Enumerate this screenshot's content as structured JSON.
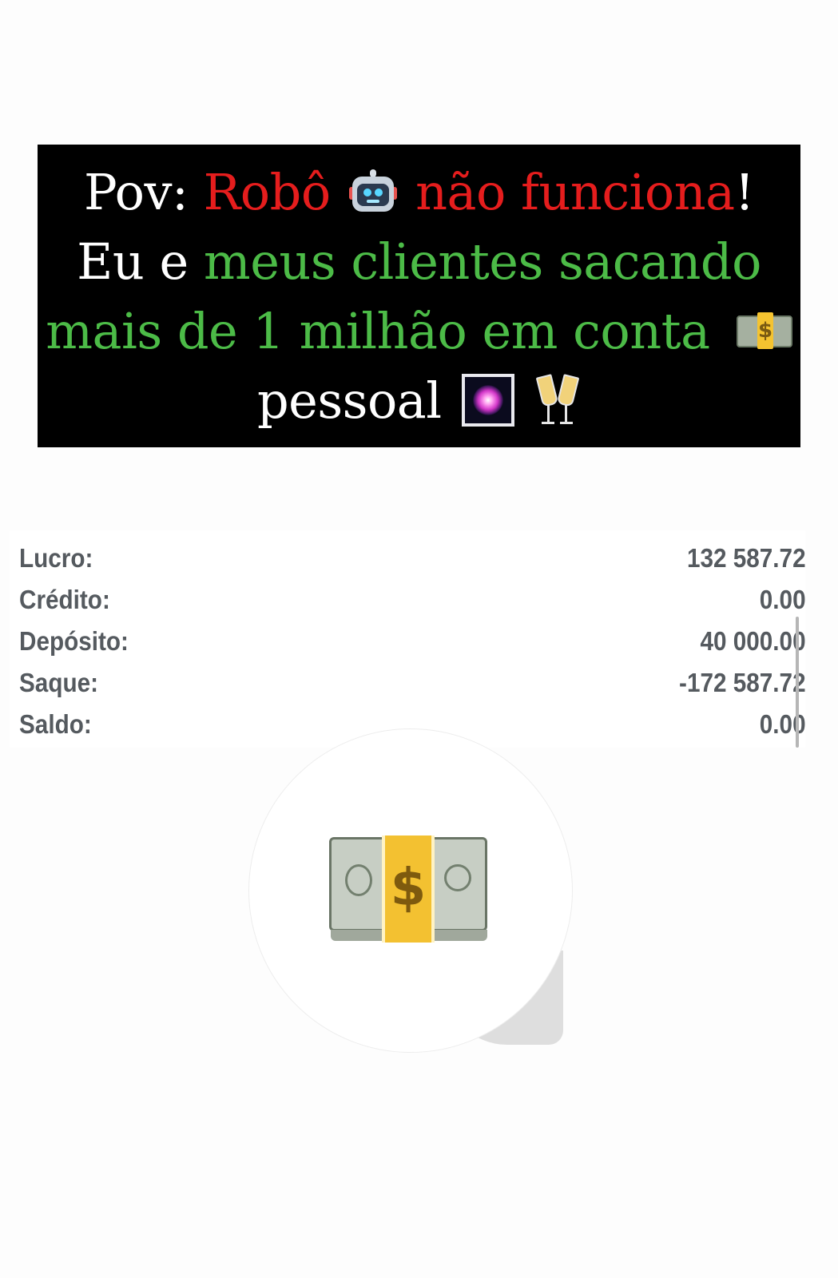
{
  "banner": {
    "line1": {
      "pov": "Pov:",
      "robo": "Robô",
      "robot_icon": "robot-icon",
      "nao_funciona": "não funciona",
      "exclaim": "!"
    },
    "line2": {
      "eu_e": "Eu e",
      "rest": "meus clientes sacando"
    },
    "line3": {
      "text": "mais de 1 milhão em conta",
      "money_icon": "money-with-wings-icon"
    },
    "line4": {
      "text": "pessoal",
      "fireworks_icon": "fireworks-icon",
      "champagne_icon": "clinking-glasses-icon"
    },
    "colors": {
      "background": "#000000",
      "red": "#e51d1d",
      "green": "#4cbb47",
      "white": "#ffffff"
    }
  },
  "summary": {
    "rows": [
      {
        "label": "Lucro:",
        "value": "132 587.72"
      },
      {
        "label": "Crédito:",
        "value": "0.00"
      },
      {
        "label": "Depósito:",
        "value": "40 000.00"
      },
      {
        "label": "Saque:",
        "value": "-172 587.72"
      },
      {
        "label": "Saldo:",
        "value": "0.00"
      }
    ]
  },
  "sticker": {
    "icon": "dollar-banknote-stack-icon",
    "sign": "$"
  }
}
